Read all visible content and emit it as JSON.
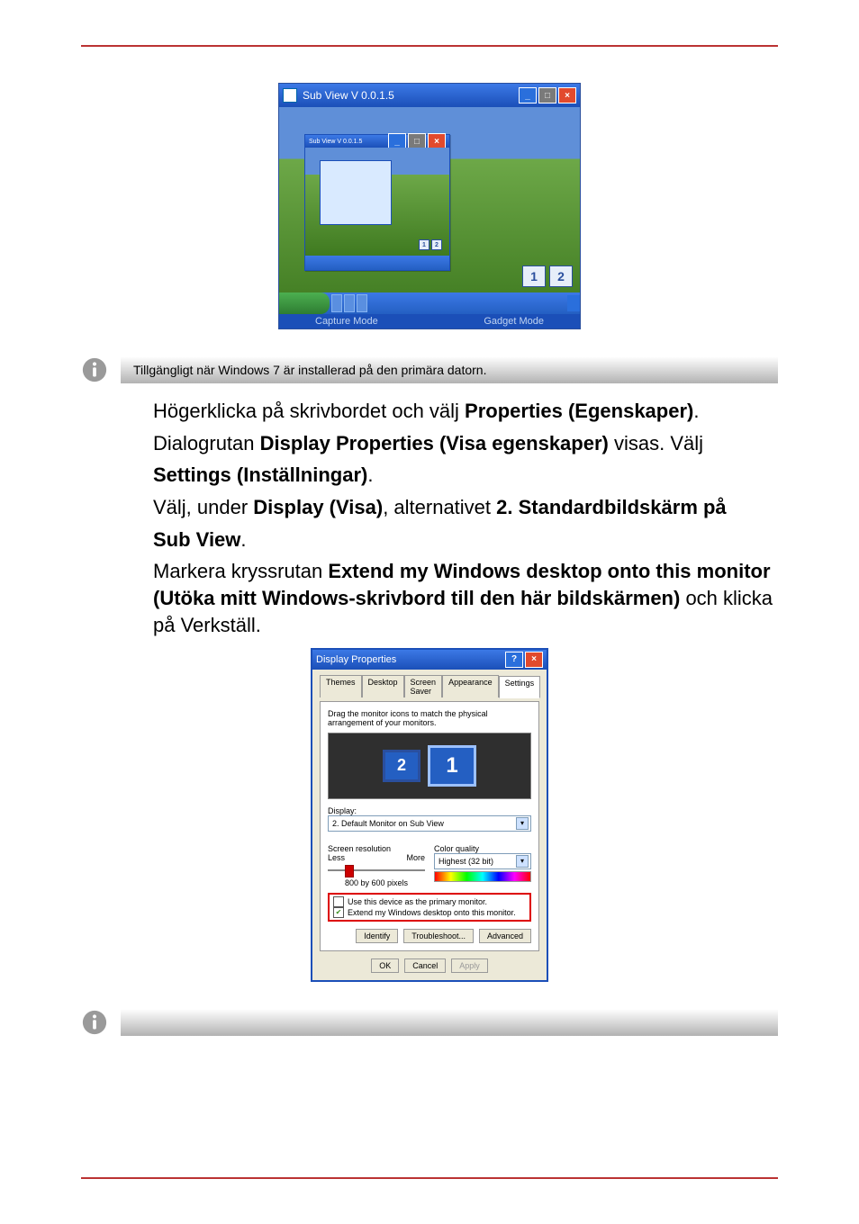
{
  "subview": {
    "title": "Sub View    V 0.0.1.5",
    "inner_title": "Sub View  V 0.0.1.5",
    "mode_capture": "Capture Mode",
    "mode_gadget": "Gadget Mode",
    "badge1": "1",
    "badge2": "2"
  },
  "info1": {
    "text": "Tillgängligt när Windows 7 är installerad på den primära datorn."
  },
  "steps_top": {
    "line1_pre": "Högerklicka på skrivbordet och välj ",
    "line1_bold": "Properties (Egenskaper)",
    "line1_post": ".",
    "line2_pre": "Dialogrutan ",
    "line2_bold": "Display Properties (Visa egenskaper)",
    "line2_post": " visas. Välj ",
    "line3_bold": "Settings (Inställningar)",
    "line3_post": ".",
    "line4_pre": "Välj, under ",
    "line4_bold1": "Display (Visa)",
    "line4_mid": ", alternativet ",
    "line4_bold2": "2. Standardbildskärm på",
    "line4_rest_bold": "Sub View",
    "line4_rest_post": ".",
    "line5_pre": "Markera kryssrutan ",
    "line5_bold": "Extend my Windows desktop onto this monitor (Utöka mitt Windows-skrivbord till den här bildskärmen)",
    "line5_post": " och klicka på Verkställ."
  },
  "dp": {
    "title": "Display Properties",
    "tabs": {
      "themes": "Themes",
      "desktop": "Desktop",
      "screensaver": "Screen Saver",
      "appearance": "Appearance",
      "settings": "Settings"
    },
    "drag_text": "Drag the monitor icons to match the physical arrangement of your monitors.",
    "mon1": "1",
    "mon2": "2",
    "display_label": "Display:",
    "display_value": "2. Default Monitor on Sub View",
    "screen_res_label": "Screen resolution",
    "less": "Less",
    "more": "More",
    "res_value": "800 by 600 pixels",
    "color_label": "Color quality",
    "color_value": "Highest (32 bit)",
    "chk_primary": "Use this device as the primary monitor.",
    "chk_extend": "Extend my Windows desktop onto this monitor.",
    "btn_identify": "Identify",
    "btn_troubleshoot": "Troubleshoot...",
    "btn_advanced": "Advanced",
    "btn_ok": "OK",
    "btn_cancel": "Cancel",
    "btn_apply": "Apply"
  },
  "info2": {
    "text": ""
  }
}
